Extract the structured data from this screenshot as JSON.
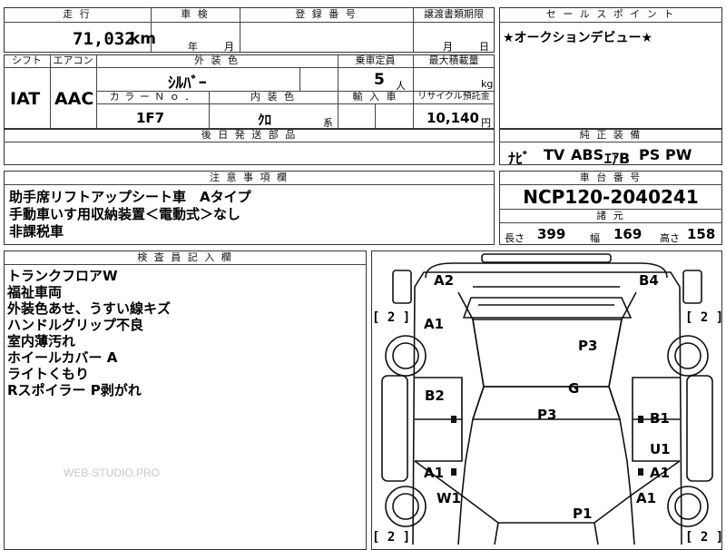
{
  "top": {
    "headers": {
      "mileage": "走 行",
      "inspection": "車 検",
      "registration_number": "登 録 番 号",
      "transfer_deadline": "譲渡書類期限",
      "sales_point": "セ ー ル ス ポ イ ン ト"
    },
    "mileage_value": "71,032",
    "mileage_unit": "km",
    "inspection_year_label": "年",
    "inspection_month_label": "月",
    "transfer_month_label": "月",
    "transfer_day_label": "日",
    "sales_point_text": "★オークションデビュー★"
  },
  "specs": {
    "headers": {
      "shift": "シフト",
      "aircon": "エアコン",
      "exterior_color": "外 装 色",
      "capacity": "乗車定員",
      "max_load": "最大積載量",
      "color_no": "カ ラ ー Ｎ ｏ ．",
      "interior_color": "内 装 色",
      "import": "輸 入 車",
      "recycle": "リサイクル預託金"
    },
    "shift_value": "IAT",
    "aircon_value": "AAC",
    "exterior_color_value": "ｼﾙﾊﾞｰ",
    "capacity_value": "5",
    "capacity_unit": "人",
    "max_load_unit": "kg",
    "color_no_value": "1F7",
    "interior_color_value": "ｸﾛ",
    "interior_color_suffix": "系",
    "recycle_value": "10,140",
    "recycle_unit": "円"
  },
  "later_parts": {
    "header": "後 日 発 送 部 品"
  },
  "genuine_equipment": {
    "header": "純 正 装 備",
    "items": [
      "ﾅﾋﾞ",
      "TV",
      "ABS",
      "ｴｱB",
      "PS",
      "PW"
    ]
  },
  "notes": {
    "header": "注 意 事 項 欄",
    "lines": [
      "助手席リフトアップシート車　Aタイプ",
      "手動車いす用収納装置＜電動式＞なし",
      "非課税車"
    ]
  },
  "chassis": {
    "header": "車 台 番 号",
    "number": "NCP120-2040241",
    "dimensions_header": "諸 元",
    "length_label": "長さ",
    "length_value": "399",
    "width_label": "幅",
    "width_value": "169",
    "height_label": "高さ",
    "height_value": "158"
  },
  "inspector": {
    "header": "検 査 員 記 入 欄",
    "lines": [
      "トランクフロアW",
      "福祉車両",
      "外装色あせ、うすい線キズ",
      "ハンドルグリップ不良",
      "室内薄汚れ",
      "ホイールカバー A",
      "ライトくもり",
      "Rスポイラー P剥がれ"
    ]
  },
  "watermark": "WEB-STUDIO.PRO",
  "diagram": {
    "tire_brackets": [
      "[ 2 ]",
      "[ 2 ]",
      "[ 2 ]",
      "[ 2 ]"
    ],
    "damage_labels": [
      "A2",
      "B4",
      "A1",
      "P3",
      "B2",
      "G",
      "P3",
      "B1",
      "U1",
      "A1",
      "A1",
      "W1",
      "A1",
      "P1"
    ]
  }
}
